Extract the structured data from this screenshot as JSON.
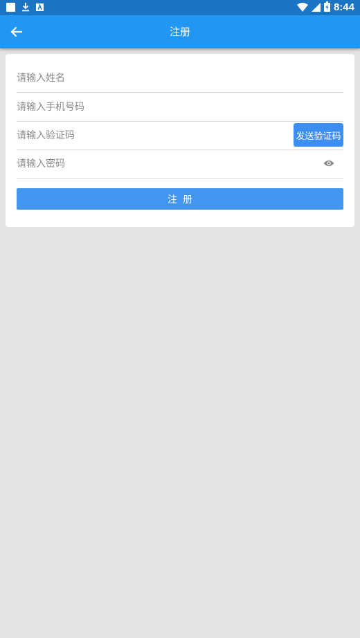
{
  "status_bar": {
    "time": "8:44",
    "left_icons": [
      "square-notification-icon",
      "download-icon",
      "a-notification-icon"
    ],
    "right_icons": [
      "wifi-icon",
      "signal-icon",
      "battery-icon"
    ]
  },
  "app_bar": {
    "title": "注册",
    "back_icon": "arrow-back-icon",
    "color": "#2196f3"
  },
  "form": {
    "name_placeholder": "请输入姓名",
    "phone_placeholder": "请输入手机号码",
    "code_placeholder": "请输入验证码",
    "password_placeholder": "请输入密码",
    "send_code_label": "发送验证码",
    "eye_icon": "eye-icon",
    "submit_label": "注册"
  },
  "colors": {
    "status_bar": "#1a76c4",
    "accent": "#2196f3",
    "button": "#4296f0",
    "background": "#e3e3e3"
  }
}
